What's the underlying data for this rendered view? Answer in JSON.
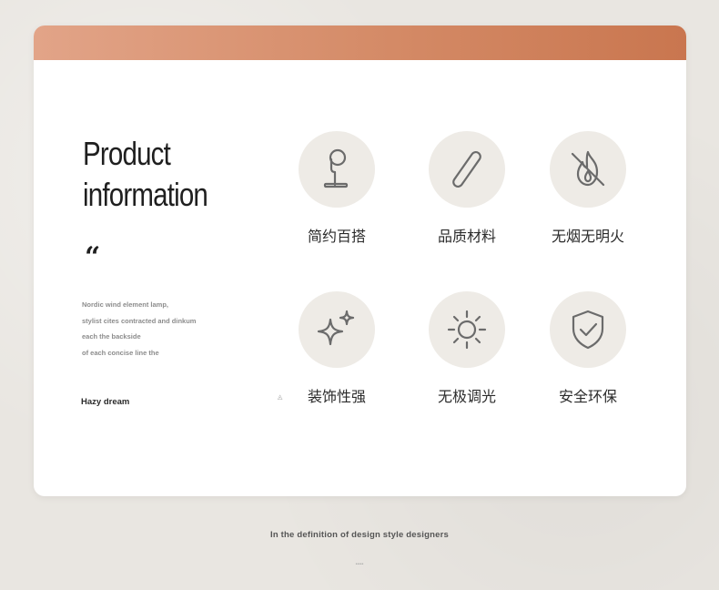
{
  "heading": {
    "line1": "Product",
    "line2": "information"
  },
  "quote_mark": "“",
  "description": [
    "Nordic wind element lamp,",
    "stylist cites contracted and dinkum",
    "each the backside",
    "of each concise line the"
  ],
  "brand": "Hazy dream",
  "features": [
    {
      "label": "简约百搭",
      "icon": "desk-lamp-icon"
    },
    {
      "label": "品质材料",
      "icon": "bar-material-icon"
    },
    {
      "label": "无烟无明火",
      "icon": "no-flame-icon"
    },
    {
      "label": "装饰性强",
      "icon": "sparkle-icon"
    },
    {
      "label": "无极调光",
      "icon": "sun-icon"
    },
    {
      "label": "安全环保",
      "icon": "shield-check-icon"
    }
  ],
  "footer_caption": "In the definition of design style designers",
  "colors": {
    "header_gradient_start": "#e2a488",
    "header_gradient_end": "#c9764f",
    "icon_circle": "#eeebe6",
    "icon_stroke": "#6b6b6b"
  }
}
